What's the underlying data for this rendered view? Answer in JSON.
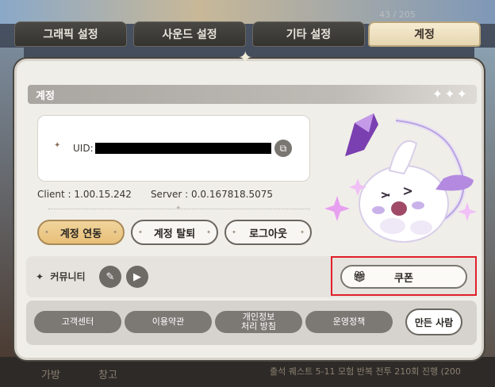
{
  "background": {
    "counter": "43 / 205",
    "bottom_left_1": "가방",
    "bottom_left_2": "창고",
    "bottom_right": "출석 퀘스트 5-11  모험 반복 전투 210회 진행 (200"
  },
  "tabs": [
    {
      "label": "그래픽 설정"
    },
    {
      "label": "사운드 설정"
    },
    {
      "label": "기타 설정"
    },
    {
      "label": "계정"
    }
  ],
  "section": {
    "title": "계정"
  },
  "uid": {
    "label": "UID:"
  },
  "version": {
    "client": "Client : 1.00.15.242",
    "server": "Server : 0.0.167818.5075"
  },
  "account_buttons": {
    "link": "계정 연동",
    "withdraw": "계정 탈퇴",
    "logout": "로그아웃"
  },
  "community": {
    "label": "커뮤니티",
    "coupon": "쿠폰"
  },
  "footer": {
    "support": "고객센터",
    "terms": "이용약관",
    "privacy_line1": "개인정보",
    "privacy_line2": "처리 방침",
    "policy": "운영정책",
    "makers": "만든 사람"
  },
  "colors": {
    "accent_gold": "#e8bf78",
    "highlight_red": "#e0202a",
    "mascot_purple": "#9a6ad8"
  }
}
